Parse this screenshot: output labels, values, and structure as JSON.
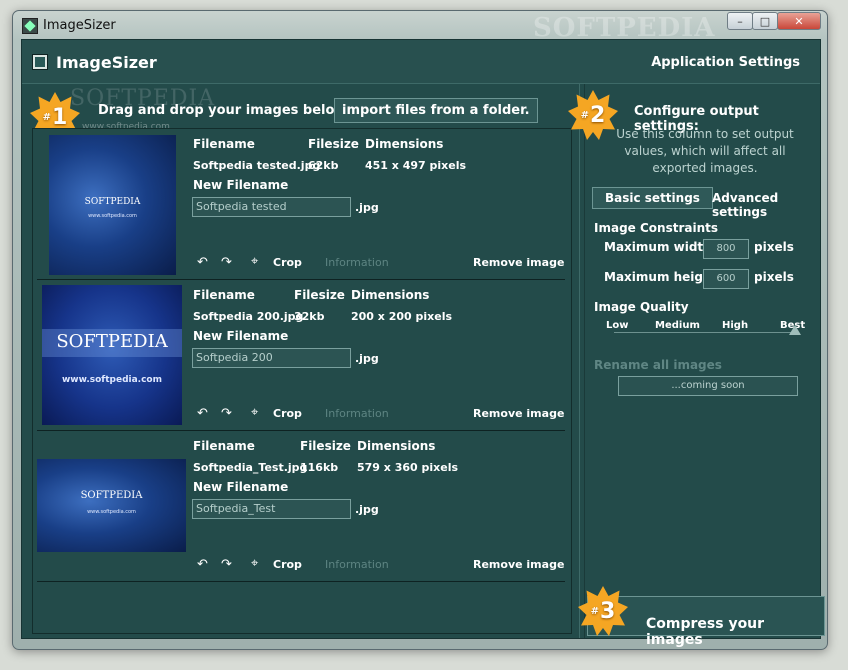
{
  "window": {
    "title": "ImageSizer",
    "watermark": "SOFTPEDIA",
    "controls": [
      "–",
      "□",
      "✕"
    ]
  },
  "app": {
    "title": "ImageSizer",
    "settings_link": "Application Settings"
  },
  "watermark": {
    "logo": "SOFTPEDIA",
    "url": "www.softpedia.com"
  },
  "step1": {
    "badge": "1",
    "hash": "#",
    "text": "Drag and drop your images below, or",
    "import_button": "import files from a folder."
  },
  "labels": {
    "filename": "Filename",
    "filesize": "Filesize",
    "dimensions": "Dimensions",
    "new_filename": "New Filename",
    "crop": "Crop",
    "information": "Information",
    "remove": "Remove image",
    "undo_icon": "↶",
    "redo_icon": "↷",
    "crop_icon": "⌖"
  },
  "images": [
    {
      "filename": "Softpedia tested.jpg",
      "filesize": "62kb",
      "dimensions": "451 x 497 pixels",
      "new_filename": "Softpedia tested",
      "ext": ".jpg",
      "thumb_logo": "SOFTPEDIA",
      "thumb_url": "www.softpedia.com"
    },
    {
      "filename": "Softpedia 200.jpg",
      "filesize": "32kb",
      "dimensions": "200 x 200 pixels",
      "new_filename": "Softpedia 200",
      "ext": ".jpg",
      "thumb_logo": "SOFTPEDIA",
      "thumb_url": "www.softpedia.com"
    },
    {
      "filename": "Softpedia_Test.jpg",
      "filesize": "116kb",
      "dimensions": "579 x 360 pixels",
      "new_filename": "Softpedia_Test",
      "ext": ".jpg",
      "thumb_logo": "SOFTPEDIA",
      "thumb_url": "www.softpedia.com"
    }
  ],
  "step2": {
    "badge": "2",
    "hash": "#",
    "title": "Configure output settings:",
    "description": "Use this column to set output values, which will affect all exported images.",
    "tab_basic": "Basic settings",
    "tab_advanced": "Advanced settings",
    "constraints_title": "Image Constraints",
    "max_width_label": "Maximum width",
    "max_width_value": "800",
    "max_height_label": "Maximum height",
    "max_height_value": "600",
    "unit": "pixels",
    "quality_title": "Image Quality",
    "quality_levels": [
      "Low",
      "Medium",
      "High",
      "Best"
    ],
    "quality_selected": "Best",
    "rename_label": "Rename all images",
    "rename_placeholder": "...coming soon"
  },
  "step3": {
    "badge": "3",
    "hash": "#",
    "button": "Compress your images"
  },
  "colors": {
    "panel": "#234b4a",
    "accent": "#f5a623",
    "border": "#6c9593"
  }
}
